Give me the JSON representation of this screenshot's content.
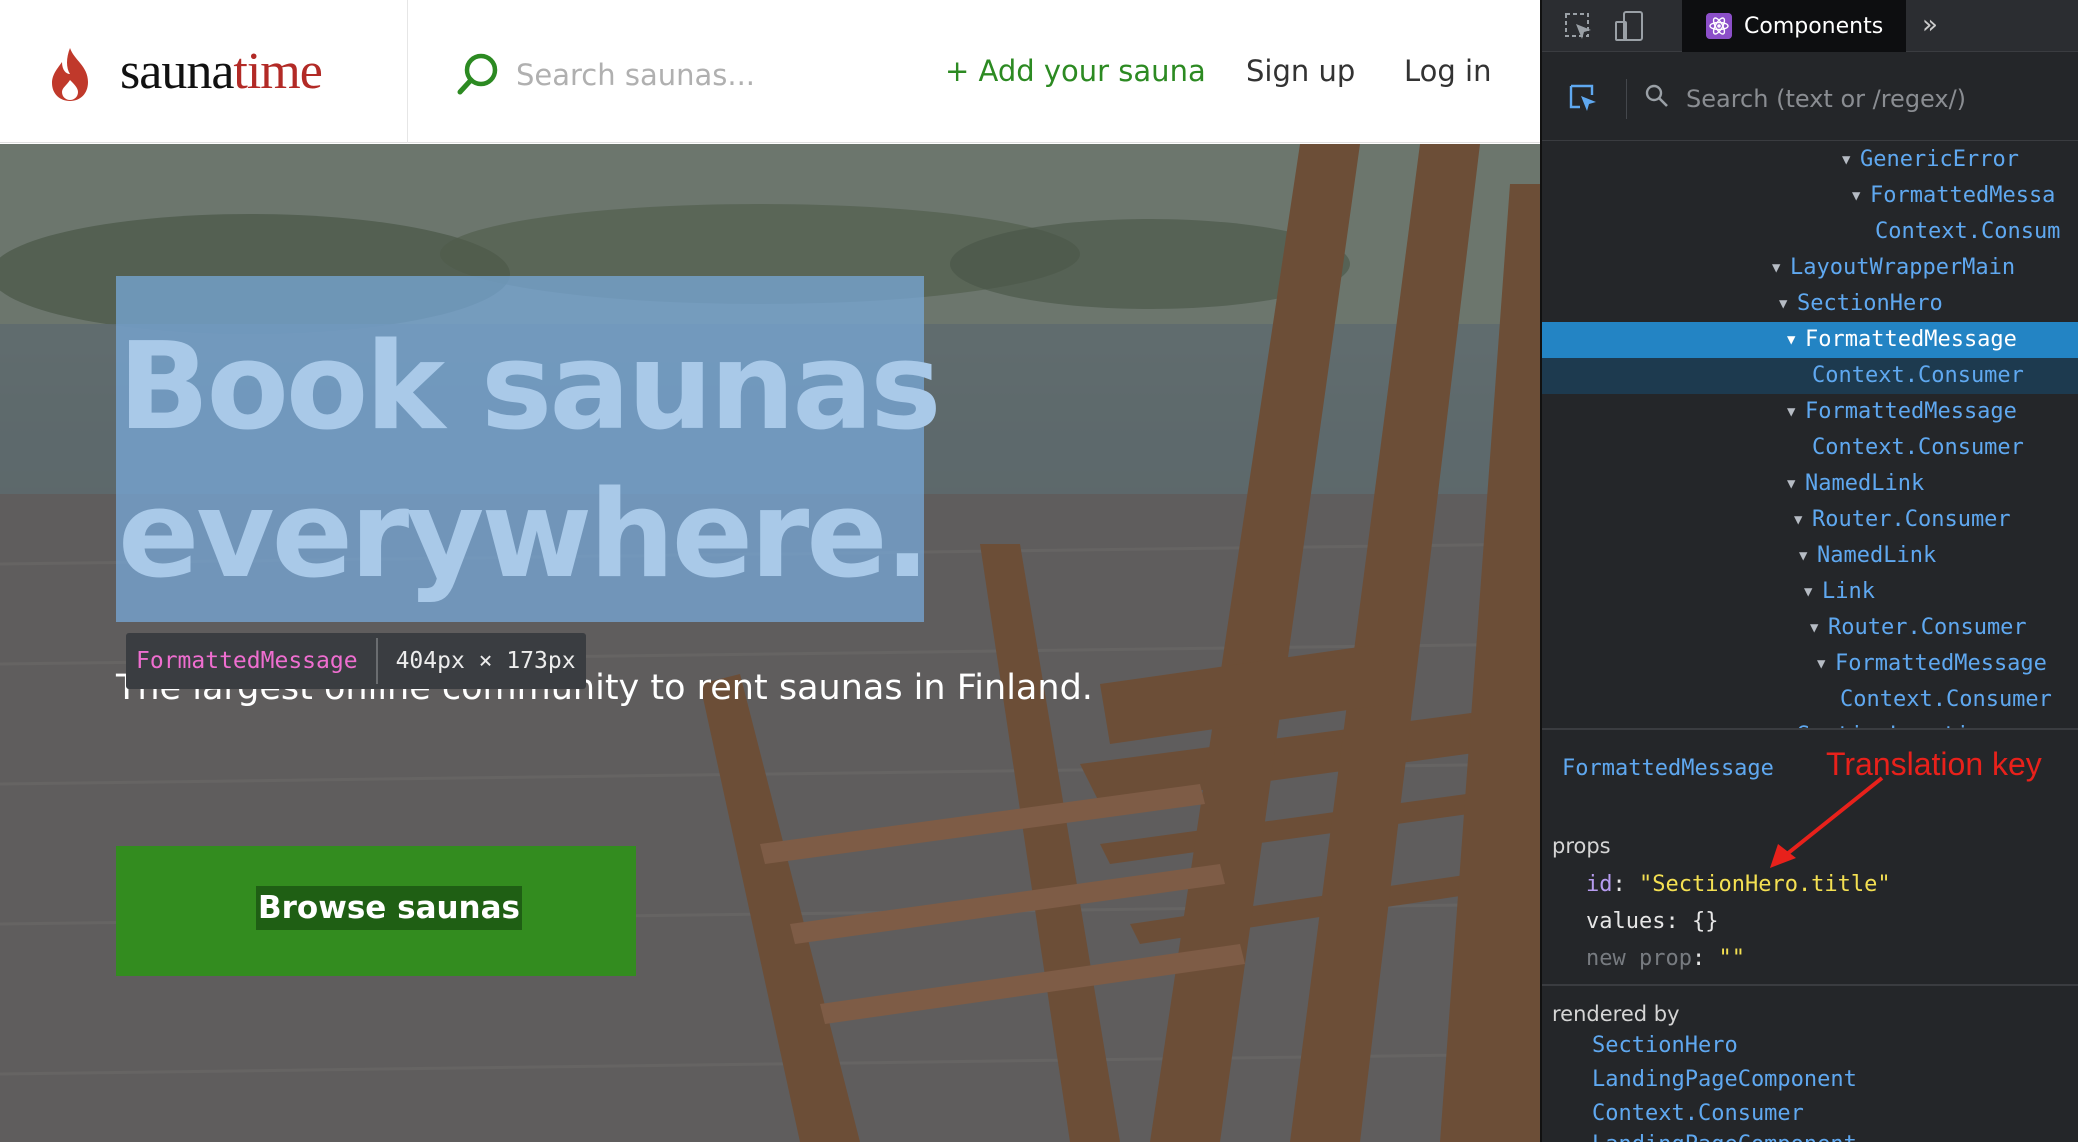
{
  "site": {
    "brand": {
      "part1": "sauna",
      "part2": "time",
      "accent": "#b22a26"
    },
    "search": {
      "placeholder": "Search saunas..."
    },
    "nav": {
      "add": "+ Add your sauna",
      "signup": "Sign up",
      "login": "Log in"
    },
    "hero": {
      "title_line1": "Book saunas",
      "title_line2": "everywhere.",
      "subtitle": "The largest online community to rent saunas in Finland.",
      "button": "Browse saunas"
    },
    "overlay_tooltip": {
      "component": "FormattedMessage",
      "size": "404px × 173px"
    },
    "colors": {
      "green": "#338c1f",
      "highlight": "#78aadc"
    }
  },
  "devtools": {
    "tab": "Components",
    "more": "»",
    "search_placeholder": "Search (text or /regex/)",
    "tree": [
      {
        "label": "GenericError",
        "indent": 1,
        "arrow": true
      },
      {
        "label": "FormattedMessa",
        "indent": 2,
        "arrow": true
      },
      {
        "label": "Context.Consum",
        "indent": 3,
        "arrow": false
      },
      {
        "label": "LayoutWrapperMain",
        "indent": 0,
        "arrow": true
      },
      {
        "label": "SectionHero",
        "indent": 0.2,
        "arrow": true
      },
      {
        "label": "FormattedMessage",
        "indent": 0.4,
        "arrow": true,
        "selected": true
      },
      {
        "label": "Context.Consumer",
        "indent": 0.6,
        "arrow": false,
        "selChild": true
      },
      {
        "label": "FormattedMessage",
        "indent": 0.4,
        "arrow": true
      },
      {
        "label": "Context.Consumer",
        "indent": 0.6,
        "arrow": false
      },
      {
        "label": "NamedLink",
        "indent": 0.4,
        "arrow": true
      },
      {
        "label": "Router.Consumer",
        "indent": 0.6,
        "arrow": true
      },
      {
        "label": "NamedLink",
        "indent": 0.8,
        "arrow": true
      },
      {
        "label": "Link",
        "indent": 1.0,
        "arrow": true
      },
      {
        "label": "Router.Consumer",
        "indent": 1.2,
        "arrow": true
      },
      {
        "label": "FormattedMessage",
        "indent": 1.4,
        "arrow": true
      },
      {
        "label": "Context.Consumer",
        "indent": 1.6,
        "arrow": false
      },
      {
        "label": "SectionLocations",
        "indent": 0.2,
        "arrow": true
      }
    ],
    "selected_component": "FormattedMessage",
    "annotation": "Translation key",
    "props_title": "props",
    "props": [
      {
        "key": "id",
        "value": "\"SectionHero.title\"",
        "type": "string"
      },
      {
        "key": "values",
        "value": "{}",
        "type": "obj"
      },
      {
        "key": "new prop",
        "value": "\"\"",
        "type": "new"
      }
    ],
    "rendered_by_title": "rendered by",
    "rendered_by": [
      "SectionHero",
      "LandingPageComponent",
      "Context.Consumer",
      "LandingPageComponent"
    ]
  }
}
